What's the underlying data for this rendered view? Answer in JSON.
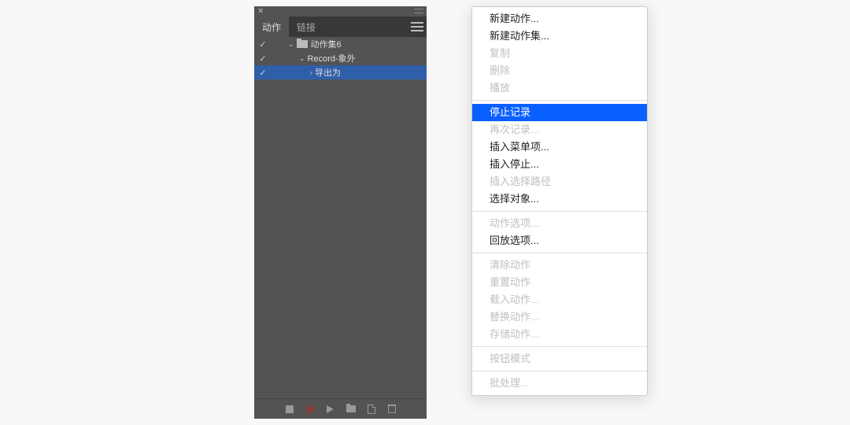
{
  "panel": {
    "tabs": [
      {
        "label": "动作",
        "active": true
      },
      {
        "label": "链接",
        "active": false
      }
    ],
    "tree": [
      {
        "checked": true,
        "level": 0,
        "expanded": true,
        "folder": true,
        "label": "动作集6",
        "selected": false,
        "play_indent": 0
      },
      {
        "checked": true,
        "level": 1,
        "expanded": true,
        "folder": false,
        "label": "Record-象外",
        "selected": false,
        "play_indent": 0
      },
      {
        "checked": true,
        "level": 2,
        "expanded": false,
        "folder": false,
        "label": "导出为",
        "selected": true,
        "play_indent": 0,
        "has_children": true
      }
    ],
    "footer_buttons": [
      "stop",
      "record",
      "play",
      "newfolder",
      "newaction",
      "trash"
    ]
  },
  "menu": {
    "groups": [
      [
        {
          "label": "新建动作...",
          "state": "enabled"
        },
        {
          "label": "新建动作集...",
          "state": "enabled"
        },
        {
          "label": "复制",
          "state": "disabled"
        },
        {
          "label": "删除",
          "state": "disabled"
        },
        {
          "label": "播放",
          "state": "disabled"
        }
      ],
      [
        {
          "label": "停止记录",
          "state": "highlighted"
        },
        {
          "label": "再次记录...",
          "state": "disabled"
        },
        {
          "label": "插入菜单项...",
          "state": "enabled"
        },
        {
          "label": "插入停止...",
          "state": "enabled"
        },
        {
          "label": "插入选择路径",
          "state": "disabled"
        },
        {
          "label": "选择对象...",
          "state": "enabled"
        }
      ],
      [
        {
          "label": "动作选项...",
          "state": "disabled"
        },
        {
          "label": "回放选项...",
          "state": "enabled"
        }
      ],
      [
        {
          "label": "清除动作",
          "state": "disabled"
        },
        {
          "label": "重置动作",
          "state": "disabled"
        },
        {
          "label": "载入动作...",
          "state": "disabled"
        },
        {
          "label": "替换动作...",
          "state": "disabled"
        },
        {
          "label": "存储动作...",
          "state": "disabled"
        }
      ],
      [
        {
          "label": "按钮模式",
          "state": "disabled"
        }
      ],
      [
        {
          "label": "批处理...",
          "state": "disabled"
        }
      ]
    ]
  }
}
